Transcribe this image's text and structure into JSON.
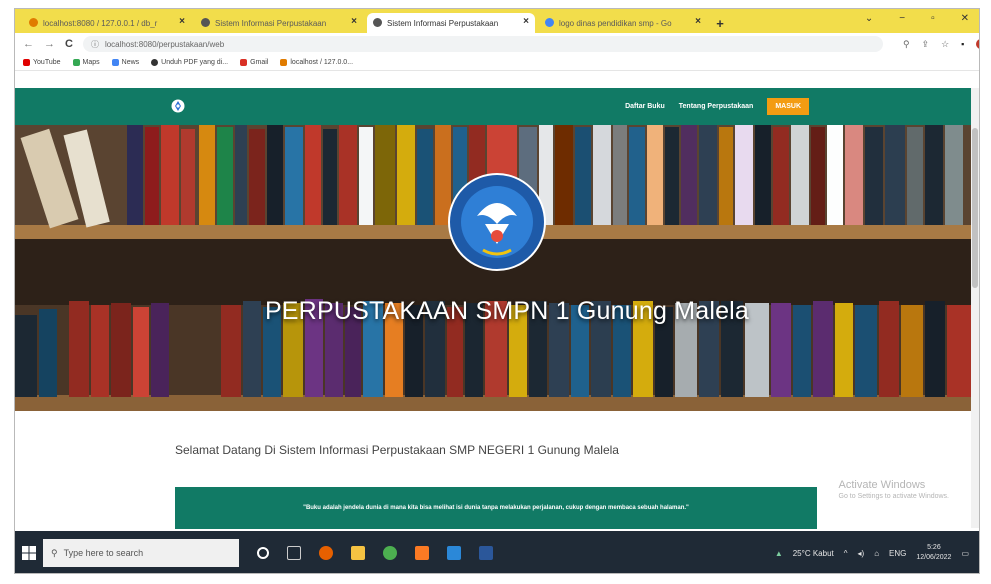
{
  "browser": {
    "tabs": [
      {
        "title": "localhost:8080 / 127.0.0.1 / db_r",
        "favicon_color": "#e07b00",
        "active": false
      },
      {
        "title": "Sistem Informasi Perpustakaan",
        "favicon_color": "#555555",
        "active": false
      },
      {
        "title": "Sistem Informasi Perpustakaan",
        "favicon_color": "#555555",
        "active": true
      },
      {
        "title": "logo dinas pendidikan smp - Go",
        "favicon_color": "#4285f4",
        "active": false
      }
    ],
    "new_tab_label": "+",
    "window_controls": {
      "dropdown": "⌄",
      "minimize": "−",
      "maximize": "▫",
      "close": "✕"
    },
    "nav": {
      "back": "←",
      "forward": "→",
      "reload": "C"
    },
    "address": "localhost:8080/perpustakaan/web",
    "bookmarks": [
      {
        "label": "YouTube",
        "color": "#e00000"
      },
      {
        "label": "Maps",
        "color": "#34a853"
      },
      {
        "label": "News",
        "color": "#4285f4"
      },
      {
        "label": "Unduh PDF yang di...",
        "color": "#333333"
      },
      {
        "label": "Gmail",
        "color": "#d93025"
      },
      {
        "label": "localhost / 127.0.0...",
        "color": "#e07b00"
      }
    ]
  },
  "site": {
    "nav_links": [
      "Daftar Buku",
      "Tentang Perpustakaan"
    ],
    "nav_button": "MASUK",
    "hero_title": "PERPUSTAKAAN SMPN 1 Gunung Malela",
    "welcome": "Selamat Datang Di Sistem Informasi Perpustakaan SMP NEGERI 1 Gunung Malela",
    "quote": "\"Buku adalah jendela dunia di mana kita bisa melihat isi dunia tanpa melakukan perjalanan, cukup dengan membaca sebuah halaman.\"",
    "watermark_title": "Activate Windows",
    "watermark_sub": "Go to Settings to activate Windows.",
    "colors": {
      "primary": "#117a65",
      "accent": "#f39c12"
    }
  },
  "taskbar": {
    "search_placeholder": "Type here to search",
    "weather": "25°C Kabut",
    "lang": "ENG",
    "time": "5:26",
    "date": "12/06/2022"
  }
}
